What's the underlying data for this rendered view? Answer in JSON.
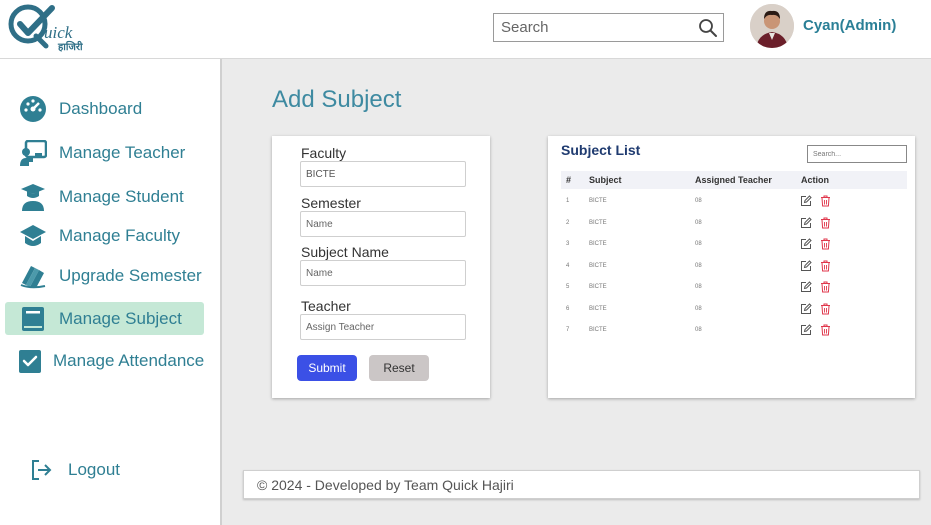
{
  "header": {
    "logo_text": "uick",
    "logo_sub": "हाजिरी",
    "search_placeholder": "Search",
    "user_name": "Cyan(Admin)"
  },
  "sidebar": {
    "items": [
      {
        "label": "Dashboard",
        "icon": "gauge-icon"
      },
      {
        "label": "Manage Teacher",
        "icon": "teacher-icon"
      },
      {
        "label": "Manage Student",
        "icon": "graduate-icon"
      },
      {
        "label": "Manage Faculty",
        "icon": "graduation-cap-icon"
      },
      {
        "label": "Upgrade Semester",
        "icon": "books-icon"
      },
      {
        "label": "Manage Subject",
        "icon": "book-icon",
        "active": true
      },
      {
        "label": "Manage Attendance",
        "icon": "checkbox-icon"
      }
    ],
    "logout": {
      "label": "Logout",
      "icon": "logout-icon"
    }
  },
  "main": {
    "page_title": "Add Subject",
    "form": {
      "faculty_label": "Faculty",
      "faculty_value": "BICTE",
      "semester_label": "Semester",
      "semester_placeholder": "Name",
      "subject_label": "Subject Name",
      "subject_placeholder": "Name",
      "teacher_label": "Teacher",
      "teacher_placeholder": "Assign Teacher",
      "submit_label": "Submit",
      "reset_label": "Reset"
    },
    "subject_list": {
      "title": "Subject List",
      "search_placeholder": "Search...",
      "columns": [
        "#",
        "Subject",
        "Assigned Teacher",
        "Action"
      ],
      "rows": [
        {
          "num": "1",
          "subject": "BICTE",
          "teacher": "08"
        },
        {
          "num": "2",
          "subject": "BICTE",
          "teacher": "08"
        },
        {
          "num": "3",
          "subject": "BICTE",
          "teacher": "08"
        },
        {
          "num": "4",
          "subject": "BICTE",
          "teacher": "08"
        },
        {
          "num": "5",
          "subject": "BICTE",
          "teacher": "08"
        },
        {
          "num": "6",
          "subject": "BICTE",
          "teacher": "08"
        },
        {
          "num": "7",
          "subject": "BICTE",
          "teacher": "08"
        }
      ]
    }
  },
  "footer": {
    "text": "© 2024 - Developed by Team Quick Hajiri"
  },
  "colors": {
    "accent": "#2f7f93",
    "active_bg": "#c5e8d6",
    "submit": "#3b50e6",
    "delete": "#e0364b"
  }
}
